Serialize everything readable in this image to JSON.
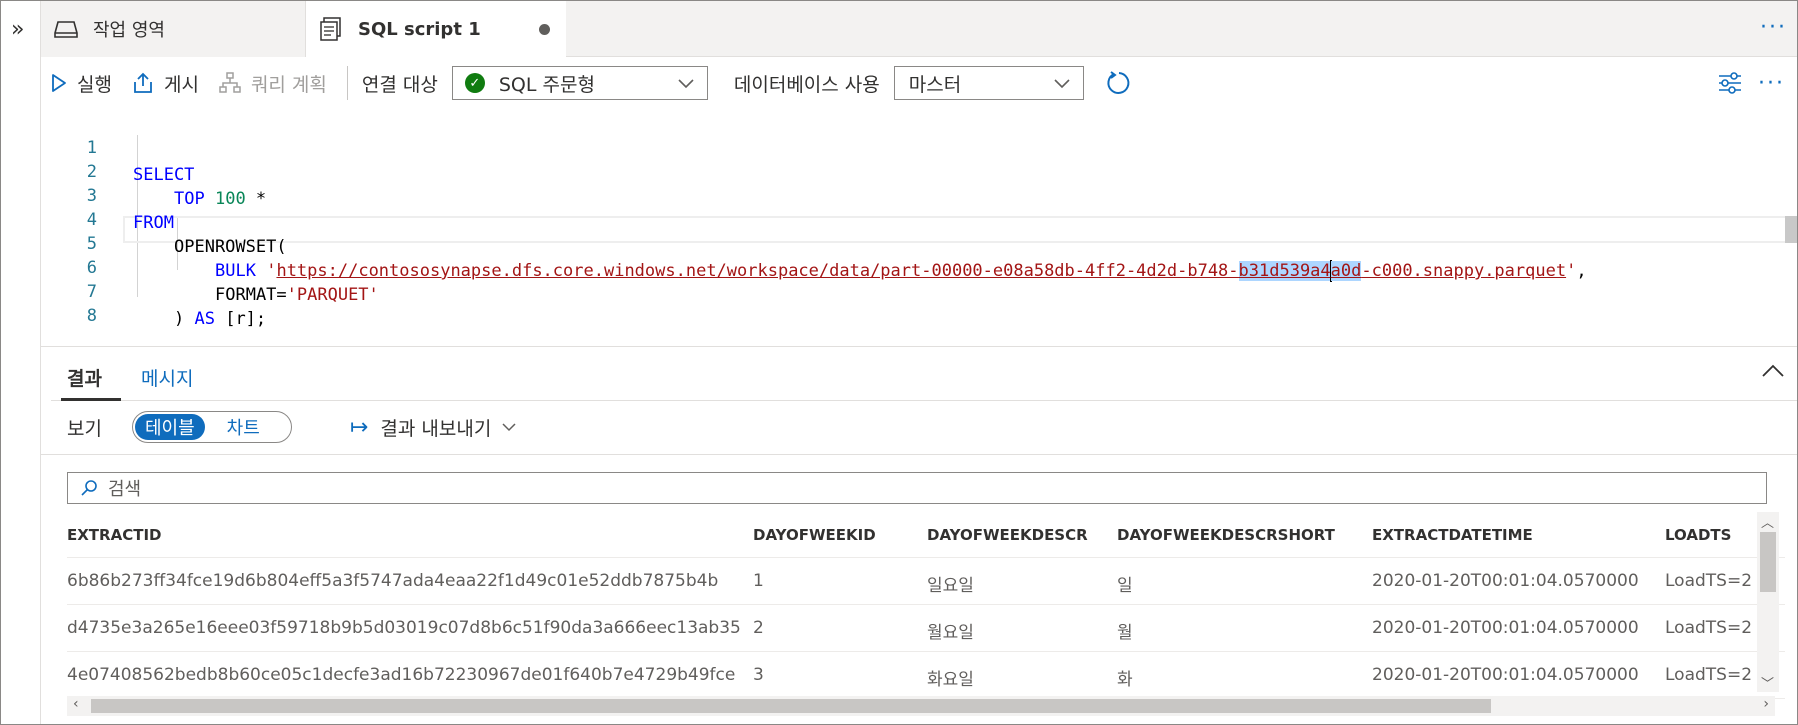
{
  "tabs": {
    "workspace_label": "작업 영역",
    "sql_label": "SQL script 1",
    "more_label": "···"
  },
  "toolbar": {
    "run_label": "실행",
    "publish_label": "게시",
    "query_plan_label": "쿼리 계획",
    "connect_to_label": "연결 대상",
    "connection_value": "SQL 주문형",
    "use_database_label": "데이터베이스 사용",
    "database_value": "마스터",
    "more_label": "···"
  },
  "editor": {
    "lines": [
      {
        "num": "1",
        "kw1": "SELECT"
      },
      {
        "num": "2",
        "kw1": "TOP",
        "num_val": "100",
        "rest": " *"
      },
      {
        "num": "3",
        "kw1": "FROM"
      },
      {
        "num": "4",
        "text": "OPENROWSET("
      },
      {
        "num": "5",
        "kw1": "BULK",
        "str_open": "'",
        "url_a": "https://contososynapse.dfs.core.windows.net/workspace/data/part-00000-e08a58db-4ff2-4d2d-b748-",
        "url_hl1": "b31d539a4",
        "url_hl2": "a0d",
        "url_b": "-c000.snappy.parquet",
        "str_close": "'",
        "rest": ","
      },
      {
        "num": "6",
        "text": "FORMAT=",
        "str": "'PARQUET'"
      },
      {
        "num": "7",
        "text": ") ",
        "kw1": "AS",
        "rest": " [r];"
      },
      {
        "num": "8"
      }
    ]
  },
  "results": {
    "tab_results": "결과",
    "tab_messages": "메시지",
    "view_label": "보기",
    "view_table": "테이블",
    "view_chart": "차트",
    "export_label": "결과 내보내기",
    "search_placeholder": "검색",
    "columns": [
      "EXTRACTID",
      "DAYOFWEEKID",
      "DAYOFWEEKDESCR",
      "DAYOFWEEKDESCRSHORT",
      "EXTRACTDATETIME",
      "LOADTS"
    ],
    "rows": [
      [
        "6b86b273ff34fce19d6b804eff5a3f5747ada4eaa22f1d49c01e52ddb7875b4b",
        "1",
        "일요일",
        "일",
        "2020-01-20T00:01:04.0570000",
        "LoadTS=2"
      ],
      [
        "d4735e3a265e16eee03f59718b9b5d03019c07d8b6c51f90da3a666eec13ab35",
        "2",
        "월요일",
        "월",
        "2020-01-20T00:01:04.0570000",
        "LoadTS=2"
      ],
      [
        "4e07408562bedb8b60ce05c1decfe3ad16b72230967de01f640b7e4729b49fce",
        "3",
        "화요일",
        "화",
        "2020-01-20T00:01:04.0570000",
        "LoadTS=2"
      ]
    ]
  },
  "colors": {
    "accent": "#0f6cbd",
    "keyword": "#0000ff",
    "string": "#a31515",
    "number": "#098658",
    "success": "#107c10"
  }
}
